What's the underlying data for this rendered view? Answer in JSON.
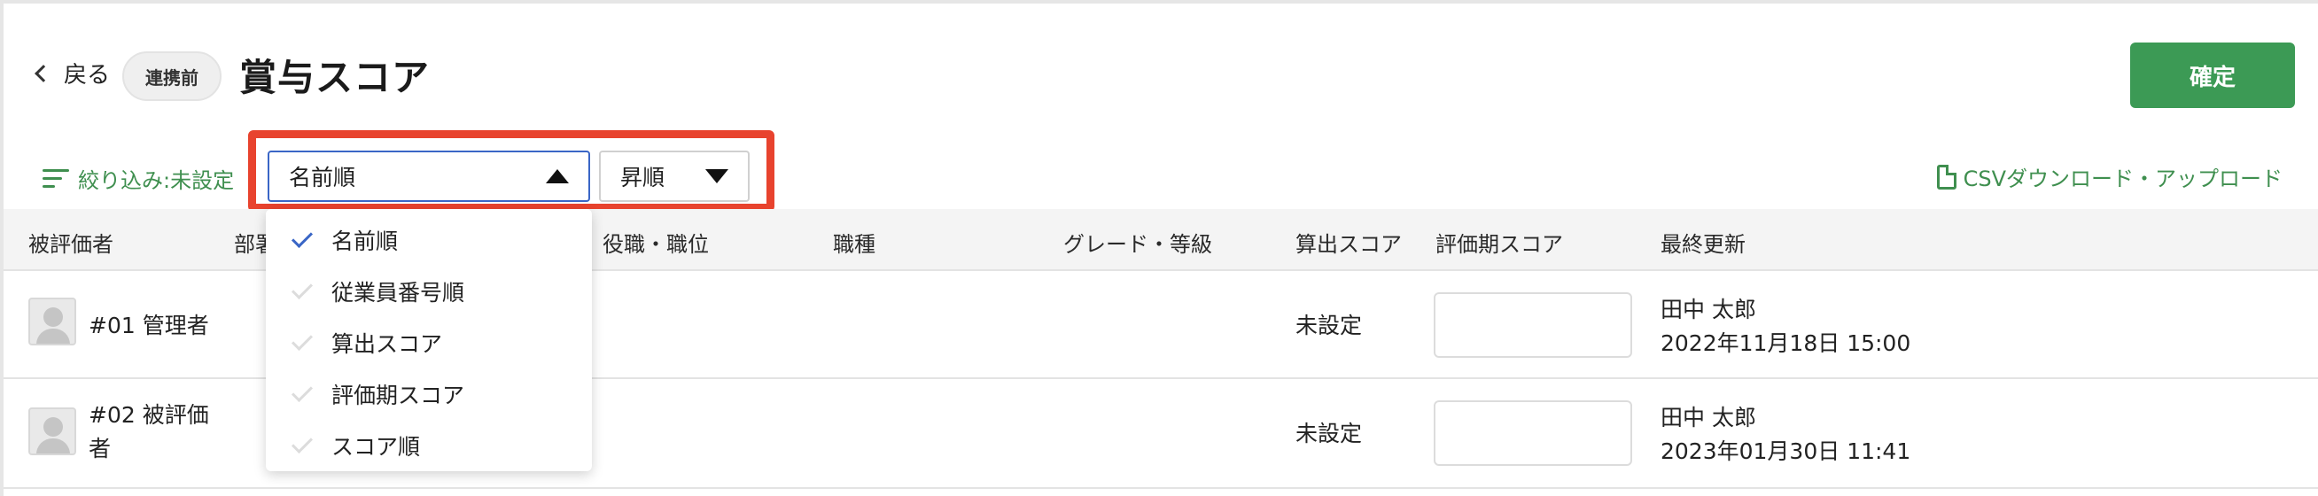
{
  "header": {
    "back_label": "戻る",
    "status_badge": "連携前",
    "title": "賞与スコア",
    "confirm_label": "確定"
  },
  "toolbar": {
    "filter_label": "絞り込み:未設定",
    "sort_value": "名前順",
    "order_value": "昇順",
    "csv_label": "CSVダウンロード・アップロード"
  },
  "table": {
    "columns": [
      "被評価者",
      "部署",
      "役職・職位",
      "職種",
      "グレード・等級",
      "算出スコア",
      "評価期スコア",
      "最終更新"
    ],
    "rows": [
      {
        "name": "#01 管理者",
        "calc_score": "未設定",
        "updated_by": "田中 太郎",
        "updated_at": "2022年11月18日 15:00"
      },
      {
        "name": "#02 被評価者",
        "calc_score": "未設定",
        "updated_by": "田中 太郎",
        "updated_at": "2023年01月30日 11:41"
      }
    ]
  },
  "sort_menu": {
    "items": [
      {
        "label": "名前順",
        "selected": true
      },
      {
        "label": "従業員番号順",
        "selected": false
      },
      {
        "label": "算出スコア",
        "selected": false
      },
      {
        "label": "評価期スコア",
        "selected": false
      },
      {
        "label": "スコア順",
        "selected": false
      }
    ]
  },
  "colors": {
    "accent_green": "#3c9a55",
    "highlight_red": "#e8432e",
    "select_blue": "#3a66c6"
  }
}
